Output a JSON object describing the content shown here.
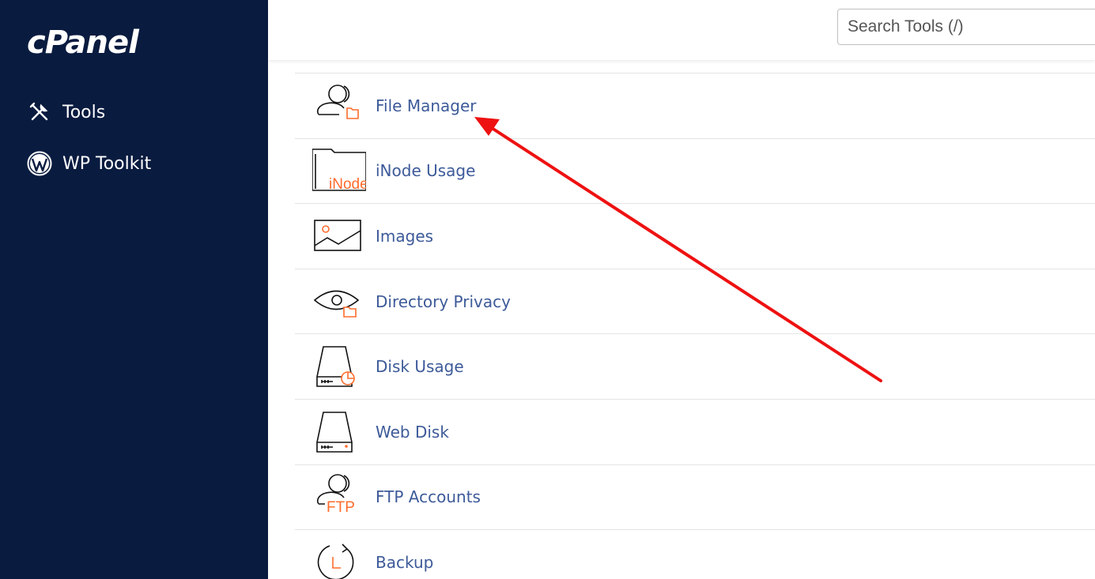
{
  "brand": {
    "logo_text": "cPanel"
  },
  "sidebar": {
    "items": [
      {
        "label": "Tools",
        "icon": "tools-icon"
      },
      {
        "label": "WP Toolkit",
        "icon": "wordpress-icon"
      }
    ]
  },
  "header": {
    "search_placeholder": "Search Tools (/)"
  },
  "tools": [
    {
      "label": "File Manager",
      "icon": "file-manager-icon"
    },
    {
      "label": "iNode Usage",
      "icon": "inode-usage-icon",
      "icon_text": "iNode"
    },
    {
      "label": "Images",
      "icon": "images-icon"
    },
    {
      "label": "Directory Privacy",
      "icon": "directory-privacy-icon"
    },
    {
      "label": "Disk Usage",
      "icon": "disk-usage-icon"
    },
    {
      "label": "Web Disk",
      "icon": "web-disk-icon"
    },
    {
      "label": "FTP Accounts",
      "icon": "ftp-accounts-icon",
      "icon_text": "FTP"
    },
    {
      "label": "Backup",
      "icon": "backup-icon"
    }
  ],
  "colors": {
    "sidebar_bg": "#091b3f",
    "link": "#3d5a99",
    "accent_orange": "#ff6c2c",
    "annotation_arrow": "#ee1111"
  }
}
